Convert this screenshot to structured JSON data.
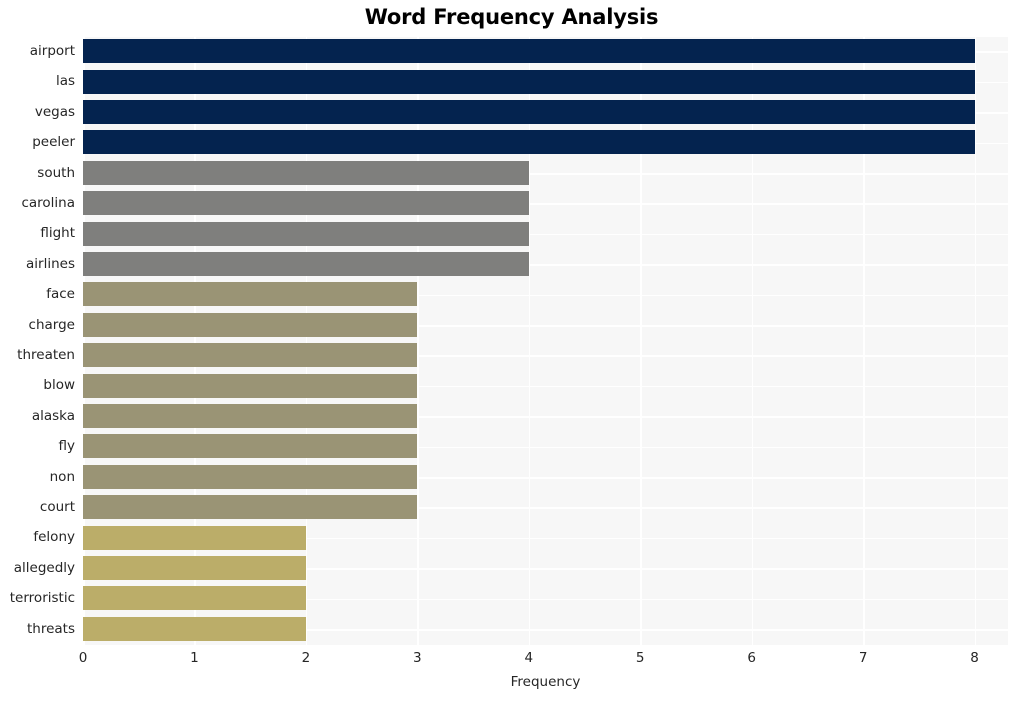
{
  "chart_data": {
    "type": "bar",
    "orientation": "horizontal",
    "title": "Word Frequency Analysis",
    "xlabel": "Frequency",
    "ylabel": "",
    "xlim": [
      0,
      8.3
    ],
    "xticks": [
      0,
      1,
      2,
      3,
      4,
      5,
      6,
      7,
      8
    ],
    "xticklabels": [
      "0",
      "1",
      "2",
      "3",
      "4",
      "5",
      "6",
      "7",
      "8"
    ],
    "grid": true,
    "legend": false,
    "categories": [
      "airport",
      "las",
      "vegas",
      "peeler",
      "south",
      "carolina",
      "flight",
      "airlines",
      "face",
      "charge",
      "threaten",
      "blow",
      "alaska",
      "fly",
      "non",
      "court",
      "felony",
      "allegedly",
      "terroristic",
      "threats"
    ],
    "values": [
      8,
      8,
      8,
      8,
      4,
      4,
      4,
      4,
      3,
      3,
      3,
      3,
      3,
      3,
      3,
      3,
      2,
      2,
      2,
      2
    ],
    "bar_colors": [
      "#04234f",
      "#04234f",
      "#04234f",
      "#04234f",
      "#7f7f7d",
      "#7f7f7d",
      "#7f7f7d",
      "#7f7f7d",
      "#9a9475",
      "#9a9475",
      "#9a9475",
      "#9a9475",
      "#9a9475",
      "#9a9475",
      "#9a9475",
      "#9a9475",
      "#bbad69",
      "#bbad69",
      "#bbad69",
      "#bbad69"
    ],
    "palette": {
      "navy": "#04234f",
      "gray": "#7f7f7d",
      "olive": "#9a9475",
      "tan": "#bbad69"
    },
    "style": {
      "plot_background": "#f7f7f7",
      "figure_background": "#ffffff",
      "gridline_color": "#ffffff",
      "tick_label_color": "#262626",
      "title_color": "#000000"
    }
  }
}
